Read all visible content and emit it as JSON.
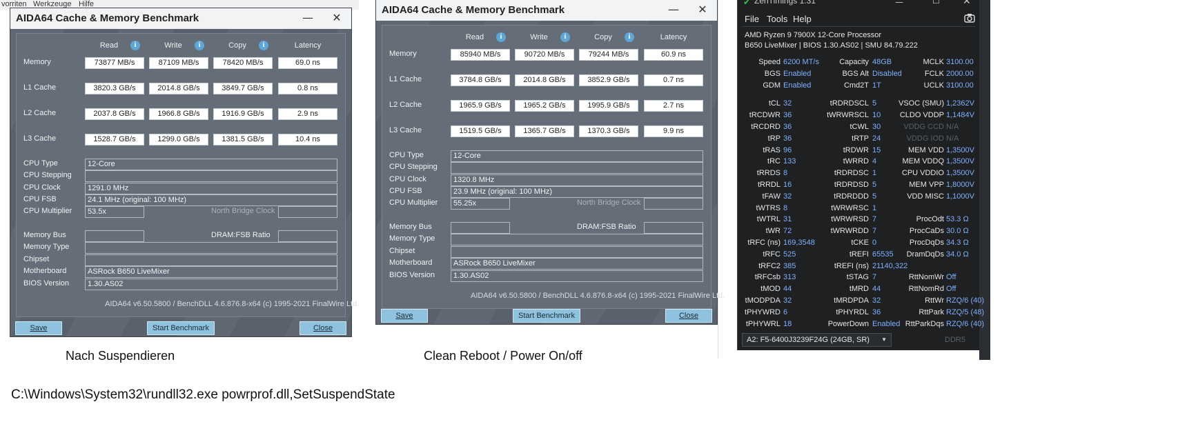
{
  "background": {
    "menu_left": [
      "vorriten",
      "Werkzeuge",
      "Hilfe"
    ]
  },
  "windows": [
    {
      "title": "AIDA64 Cache & Memory Benchmark",
      "headers": {
        "read": "Read",
        "write": "Write",
        "copy": "Copy",
        "latency": "Latency"
      },
      "rows": [
        {
          "label": "Memory",
          "read": "73877 MB/s",
          "write": "87109 MB/s",
          "copy": "78420 MB/s",
          "latency": "69.0 ns"
        },
        {
          "label": "L1 Cache",
          "read": "3820.3 GB/s",
          "write": "2014.8 GB/s",
          "copy": "3849.7 GB/s",
          "latency": "0.8 ns"
        },
        {
          "label": "L2 Cache",
          "read": "2037.8 GB/s",
          "write": "1966.8 GB/s",
          "copy": "1916.9 GB/s",
          "latency": "2.9 ns"
        },
        {
          "label": "L3 Cache",
          "read": "1528.7 GB/s",
          "write": "1299.0 GB/s",
          "copy": "1381.5 GB/s",
          "latency": "10.4 ns"
        }
      ],
      "info": {
        "cpu_type_label": "CPU Type",
        "cpu_type": "12-Core",
        "cpu_stepping_label": "CPU Stepping",
        "cpu_stepping": "",
        "cpu_clock_label": "CPU Clock",
        "cpu_clock": "1291.0 MHz",
        "cpu_fsb_label": "CPU FSB",
        "cpu_fsb": "24.1 MHz  (original: 100 MHz)",
        "cpu_mult_label": "CPU Multiplier",
        "cpu_mult": "53.5x",
        "nb_clock_label": "North Bridge Clock",
        "mem_bus_label": "Memory Bus",
        "dram_ratio_label": "DRAM:FSB Ratio",
        "mem_type_label": "Memory Type",
        "chipset_label": "Chipset",
        "motherboard_label": "Motherboard",
        "motherboard": "ASRock B650 LiveMixer",
        "bios_label": "BIOS Version",
        "bios": "1.30.AS02"
      },
      "footer": "AIDA64 v6.50.5800 / BenchDLL 4.6.876.8-x64  (c) 1995-2021 FinalWire Ltd.",
      "buttons": {
        "save": "Save",
        "start": "Start Benchmark",
        "close": "Close"
      },
      "caption": "Nach Suspendieren"
    },
    {
      "title": "AIDA64 Cache & Memory Benchmark",
      "headers": {
        "read": "Read",
        "write": "Write",
        "copy": "Copy",
        "latency": "Latency"
      },
      "rows": [
        {
          "label": "Memory",
          "read": "85940 MB/s",
          "write": "90720 MB/s",
          "copy": "79244 MB/s",
          "latency": "60.9 ns"
        },
        {
          "label": "L1 Cache",
          "read": "3784.8 GB/s",
          "write": "2014.8 GB/s",
          "copy": "3852.9 GB/s",
          "latency": "0.7 ns"
        },
        {
          "label": "L2 Cache",
          "read": "1965.9 GB/s",
          "write": "1965.2 GB/s",
          "copy": "1995.9 GB/s",
          "latency": "2.7 ns"
        },
        {
          "label": "L3 Cache",
          "read": "1519.5 GB/s",
          "write": "1365.7 GB/s",
          "copy": "1370.3 GB/s",
          "latency": "9.9 ns"
        }
      ],
      "info": {
        "cpu_type_label": "CPU Type",
        "cpu_type": "12-Core",
        "cpu_stepping_label": "CPU Stepping",
        "cpu_stepping": "",
        "cpu_clock_label": "CPU Clock",
        "cpu_clock": "1320.8 MHz",
        "cpu_fsb_label": "CPU FSB",
        "cpu_fsb": "23.9 MHz  (original: 100 MHz)",
        "cpu_mult_label": "CPU Multiplier",
        "cpu_mult": "55.25x",
        "nb_clock_label": "North Bridge Clock",
        "mem_bus_label": "Memory Bus",
        "dram_ratio_label": "DRAM:FSB Ratio",
        "mem_type_label": "Memory Type",
        "chipset_label": "Chipset",
        "motherboard_label": "Motherboard",
        "motherboard": "ASRock B650 LiveMixer",
        "bios_label": "BIOS Version",
        "bios": "1.30.AS02"
      },
      "footer": "AIDA64 v6.50.5800 / BenchDLL 4.6.876.8-x64  (c) 1995-2021 FinalWire Ltd.",
      "buttons": {
        "save": "Save",
        "start": "Start Benchmark",
        "close": "Close"
      },
      "caption": "Clean Reboot / Power On/off"
    }
  ],
  "zen": {
    "title": "ZenTimings 1.31",
    "menu": [
      "File",
      "Tools",
      "Help"
    ],
    "cpu_line1": "AMD Ryzen 9 7900X 12-Core Processor",
    "cpu_line2": "B650 LiveMixer | BIOS 1.30.AS02 | SMU 84.79.222",
    "rows": [
      [
        [
          "Speed",
          "6200 MT/s"
        ],
        [
          "Capacity",
          "48GB"
        ],
        [
          "MCLK",
          "3100.00"
        ]
      ],
      [
        [
          "BGS",
          "Enabled"
        ],
        [
          "BGS Alt",
          "Disabled"
        ],
        [
          "FCLK",
          "2000.00"
        ]
      ],
      [
        [
          "GDM",
          "Enabled"
        ],
        [
          "Cmd2T",
          "1T"
        ],
        [
          "UCLK",
          "3100.00"
        ]
      ],
      [
        [
          "tCL",
          "32"
        ],
        [
          "tRDRDSCL",
          "5"
        ],
        [
          "VSOC (SMU)",
          "1,2362V"
        ]
      ],
      [
        [
          "tRCDWR",
          "36"
        ],
        [
          "tWRWRSCL",
          "10"
        ],
        [
          "CLDO VDDP",
          "1,1484V"
        ]
      ],
      [
        [
          "tRCDRD",
          "36"
        ],
        [
          "tCWL",
          "30"
        ],
        [
          "VDDG CCD",
          "N/A"
        ]
      ],
      [
        [
          "tRP",
          "36"
        ],
        [
          "tRTP",
          "24"
        ],
        [
          "VDDG IOD",
          "N/A"
        ]
      ],
      [
        [
          "tRAS",
          "96"
        ],
        [
          "tRDWR",
          "15"
        ],
        [
          "MEM VDD",
          "1,3500V"
        ]
      ],
      [
        [
          "tRC",
          "133"
        ],
        [
          "tWRRD",
          "4"
        ],
        [
          "MEM VDDQ",
          "1,3500V"
        ]
      ],
      [
        [
          "tRRDS",
          "8"
        ],
        [
          "tRDRDSC",
          "1"
        ],
        [
          "CPU VDDIO",
          "1,3500V"
        ]
      ],
      [
        [
          "tRRDL",
          "16"
        ],
        [
          "tRDRDSD",
          "5"
        ],
        [
          "MEM VPP",
          "1,8000V"
        ]
      ],
      [
        [
          "tFAW",
          "32"
        ],
        [
          "tRDRDDD",
          "5"
        ],
        [
          "VDD MISC",
          "1,1000V"
        ]
      ],
      [
        [
          "tWTRS",
          "8"
        ],
        [
          "tWRWRSC",
          "1"
        ],
        [
          "",
          ""
        ]
      ],
      [
        [
          "tWTRL",
          "31"
        ],
        [
          "tWRWRSD",
          "7"
        ],
        [
          "ProcOdt",
          "53.3 Ω"
        ]
      ],
      [
        [
          "tWR",
          "72"
        ],
        [
          "tWRWRDD",
          "7"
        ],
        [
          "ProcCaDs",
          "30.0 Ω"
        ]
      ],
      [
        [
          "tRFC (ns)",
          "169,3548"
        ],
        [
          "tCKE",
          "0"
        ],
        [
          "ProcDqDs",
          "34.3 Ω"
        ]
      ],
      [
        [
          "tRFC",
          "525"
        ],
        [
          "tREFI",
          "65535"
        ],
        [
          "DramDqDs",
          "34.0 Ω"
        ]
      ],
      [
        [
          "tRFC2",
          "385"
        ],
        [
          "tREFI (ns)",
          "21140,322"
        ],
        [
          "",
          ""
        ]
      ],
      [
        [
          "tRFCsb",
          "313"
        ],
        [
          "tSTAG",
          "7"
        ],
        [
          "RttNomWr",
          "Off"
        ]
      ],
      [
        [
          "tMOD",
          "44"
        ],
        [
          "tMRD",
          "44"
        ],
        [
          "RttNomRd",
          "Off"
        ]
      ],
      [
        [
          "tMODPDA",
          "32"
        ],
        [
          "tMRDPDA",
          "32"
        ],
        [
          "RttWr",
          "RZQ/6 (40)"
        ]
      ],
      [
        [
          "tPHYWRD",
          "6"
        ],
        [
          "tPHYRDL",
          "36"
        ],
        [
          "RttPark",
          "RZQ/5 (48)"
        ]
      ],
      [
        [
          "tPHYWRL",
          "18"
        ],
        [
          "PowerDown",
          "Enabled"
        ],
        [
          "RttParkDqs",
          "RZQ/6 (40)"
        ]
      ]
    ],
    "na_keys": [
      "VDDG CCD",
      "VDDG IOD"
    ],
    "dimm_select": "A2: F5-6400J3239F24G (24GB, SR)",
    "ddr_label": "DDR5"
  },
  "command": "C:\\Windows\\System32\\rundll32.exe powrprof.dll,SetSuspendState"
}
